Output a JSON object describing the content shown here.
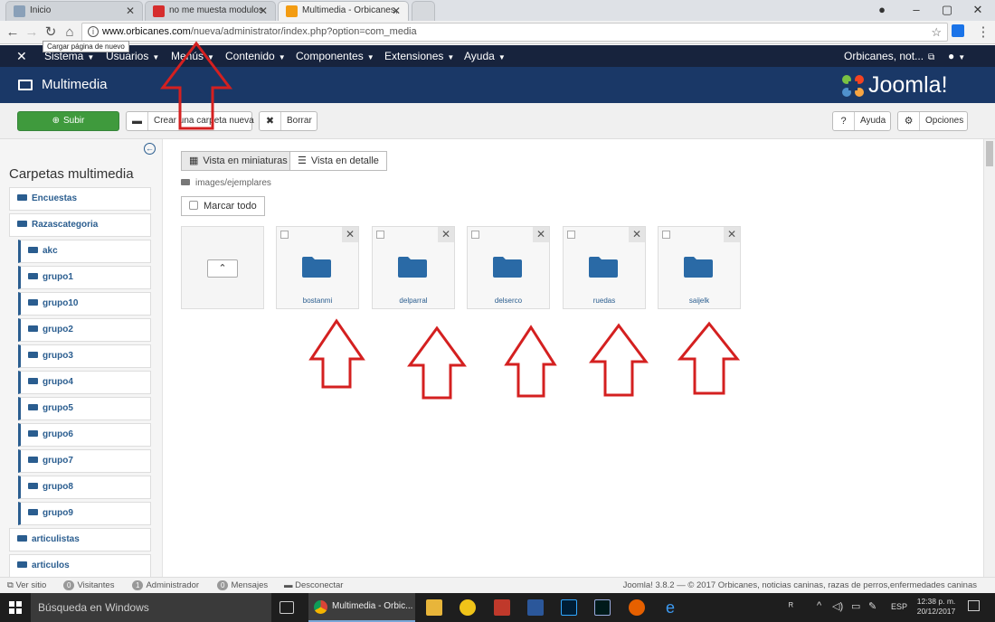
{
  "browser": {
    "tabs": [
      {
        "title": "Inicio"
      },
      {
        "title": "no me muesta modulos"
      },
      {
        "title": "Multimedia - Orbicanes,"
      }
    ],
    "url_domain": "www.orbicanes.com",
    "url_path": "/nueva/administrator/index.php?option=com_media",
    "tooltip": "Cargar página de nuevo"
  },
  "nav": {
    "menus": [
      "Sistema",
      "Usuarios",
      "Menús",
      "Contenido",
      "Componentes",
      "Extensiones",
      "Ayuda"
    ],
    "user_label": "Orbicanes, not..."
  },
  "header": {
    "title": "Multimedia",
    "logo_text": "Joomla!"
  },
  "toolbar": {
    "upload": "Subir",
    "create_folder": "Crear una carpeta nueva",
    "delete": "Borrar",
    "help": "Ayuda",
    "options": "Opciones"
  },
  "sidebar": {
    "title": "Carpetas multimedia",
    "items": [
      {
        "label": "Encuestas",
        "level": 0
      },
      {
        "label": "Razascategoria",
        "level": 0
      },
      {
        "label": "akc",
        "level": 1
      },
      {
        "label": "grupo1",
        "level": 1
      },
      {
        "label": "grupo10",
        "level": 1
      },
      {
        "label": "grupo2",
        "level": 1
      },
      {
        "label": "grupo3",
        "level": 1
      },
      {
        "label": "grupo4",
        "level": 1
      },
      {
        "label": "grupo5",
        "level": 1
      },
      {
        "label": "grupo6",
        "level": 1
      },
      {
        "label": "grupo7",
        "level": 1
      },
      {
        "label": "grupo8",
        "level": 1
      },
      {
        "label": "grupo9",
        "level": 1
      },
      {
        "label": "articulistas",
        "level": 0
      },
      {
        "label": "articulos",
        "level": 0
      }
    ]
  },
  "main": {
    "view_thumbs": "Vista en miniaturas",
    "view_detail": "Vista en detalle",
    "path": "images/ejemplares",
    "mark_all": "Marcar todo",
    "folders": [
      "bostanmi",
      "delparral",
      "delserco",
      "ruedas",
      "saijelk"
    ]
  },
  "status": {
    "view_site": "Ver sitio",
    "visitors_count": "0",
    "visitors": "Visitantes",
    "admins_count": "1",
    "admins": "Administrador",
    "messages_count": "0",
    "messages": "Mensajes",
    "logout": "Desconectar",
    "footer": "Joomla! 3.8.2 — © 2017 Orbicanes, noticias caninas, razas de perros,enfermedades caninas"
  },
  "taskbar": {
    "search": "Búsqueda en Windows",
    "active_app": "Multimedia - Orbic...",
    "lang": "ESP",
    "time": "12:38 p. m.",
    "date": "20/12/2017"
  },
  "colors": {
    "annotation": "#d42020",
    "joomla_blue": "#1a3867",
    "nav_dark": "#17233d",
    "success": "#3f9a3d"
  }
}
